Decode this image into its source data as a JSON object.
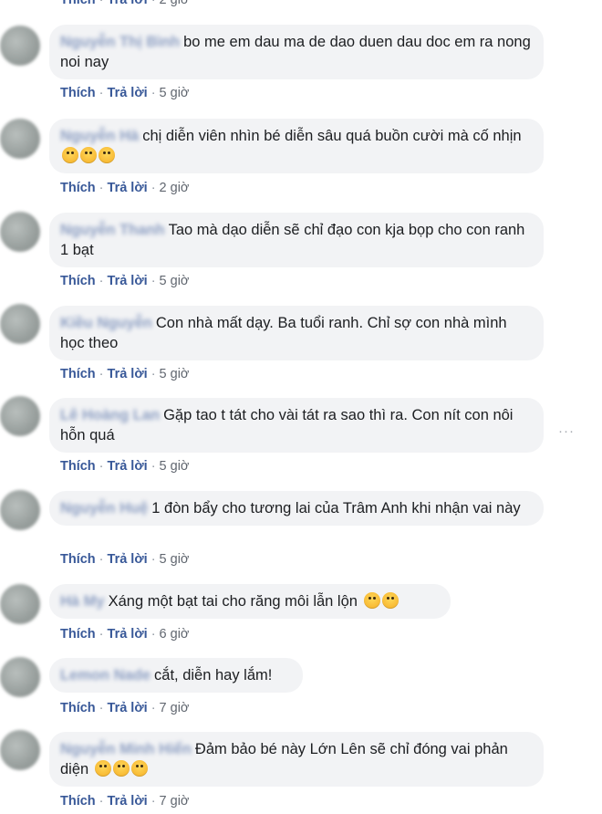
{
  "labels": {
    "like": "Thích",
    "reply": "Trả lời",
    "dot": "·"
  },
  "top_actions": {
    "time": "2 giờ"
  },
  "comments": [
    {
      "author": "Nguyễn Thị Bình",
      "text": "bo me em dau ma de dao duen dau doc em ra nong noi nay",
      "time": "5 giờ"
    },
    {
      "author": "Nguyễn Hà",
      "text": "chị diễn viên nhìn bé diễn sâu quá buồn cười mà cố nhịn",
      "emoji": [
        "laugh",
        "laugh",
        "laugh"
      ],
      "time": "2 giờ"
    },
    {
      "author": "Nguyễn Thanh",
      "text": "Tao mà dạo diễn sẽ chỉ đạo con kja bọp cho con ranh 1 bạt",
      "time": "5 giờ"
    },
    {
      "author": "Kiều Nguyễn",
      "text": "Con nhà mất dạy. Ba tuổi ranh. Chỉ sợ con nhà mình học theo",
      "time": "5 giờ"
    },
    {
      "author": "Lê Hoàng Lan",
      "text": "Gặp tao t tát cho vài tát ra sao thì ra. Con nít con nôi hỗn quá",
      "time": "5 giờ"
    },
    {
      "author": "Nguyễn Huệ",
      "text": "1 đòn bẩy cho tương lai của Trâm Anh khi nhận vai này",
      "time": "5 giờ"
    },
    {
      "author": "Hà My",
      "text": "Xáng một bạt tai cho răng môi lẫn lộn",
      "emoji": [
        "roll",
        "roll"
      ],
      "time": "6 giờ"
    },
    {
      "author": "Lemon Nade",
      "text": "cắt, diễn hay lắm!",
      "time": "7 giờ"
    },
    {
      "author": "Nguyễn Minh Hiển",
      "text": "Đảm bảo bé này Lớn Lên sẽ chỉ đóng vai phản diện",
      "emoji": [
        "astonished",
        "astonished",
        "astonished"
      ],
      "time": "7 giờ"
    }
  ],
  "colors": {
    "link": "#385898",
    "bubble": "#f2f3f5",
    "meta": "#616770"
  }
}
